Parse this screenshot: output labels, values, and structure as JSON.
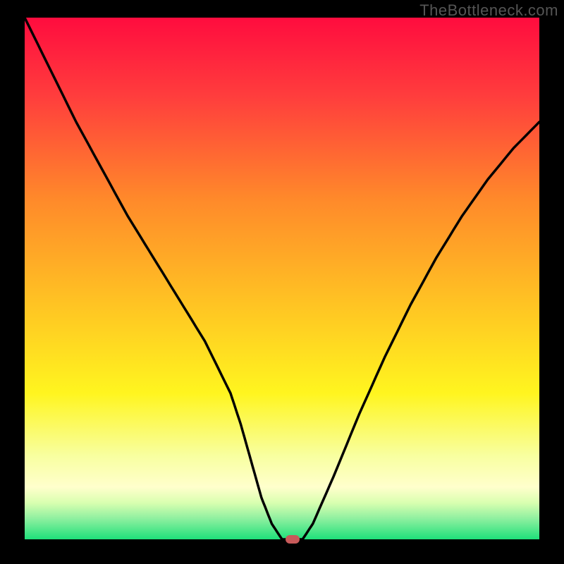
{
  "watermark": "TheBottleneck.com",
  "chart_data": {
    "type": "line",
    "title": "",
    "xlabel": "",
    "ylabel": "",
    "xlim": [
      0,
      100
    ],
    "ylim": [
      0,
      100
    ],
    "x": [
      0,
      5,
      10,
      15,
      20,
      25,
      30,
      35,
      40,
      42,
      44,
      46,
      48,
      50,
      52,
      54,
      56,
      60,
      65,
      70,
      75,
      80,
      85,
      90,
      95,
      100
    ],
    "values": [
      100,
      90,
      80,
      71,
      62,
      54,
      46,
      38,
      28,
      22,
      15,
      8,
      3,
      0,
      0,
      0,
      3,
      12,
      24,
      35,
      45,
      54,
      62,
      69,
      75,
      80
    ],
    "marker": {
      "x": 52,
      "y": 0,
      "color": "#c85a5a"
    },
    "background_gradient": [
      {
        "stop": 0.0,
        "color": "#ff0c3e"
      },
      {
        "stop": 0.15,
        "color": "#ff3d3d"
      },
      {
        "stop": 0.35,
        "color": "#ff8a2a"
      },
      {
        "stop": 0.55,
        "color": "#ffc423"
      },
      {
        "stop": 0.72,
        "color": "#fff51f"
      },
      {
        "stop": 0.84,
        "color": "#f8ffa0"
      },
      {
        "stop": 0.9,
        "color": "#ffffcc"
      },
      {
        "stop": 0.93,
        "color": "#d9ffb0"
      },
      {
        "stop": 0.96,
        "color": "#8ff0a0"
      },
      {
        "stop": 1.0,
        "color": "#1ee07a"
      }
    ]
  }
}
